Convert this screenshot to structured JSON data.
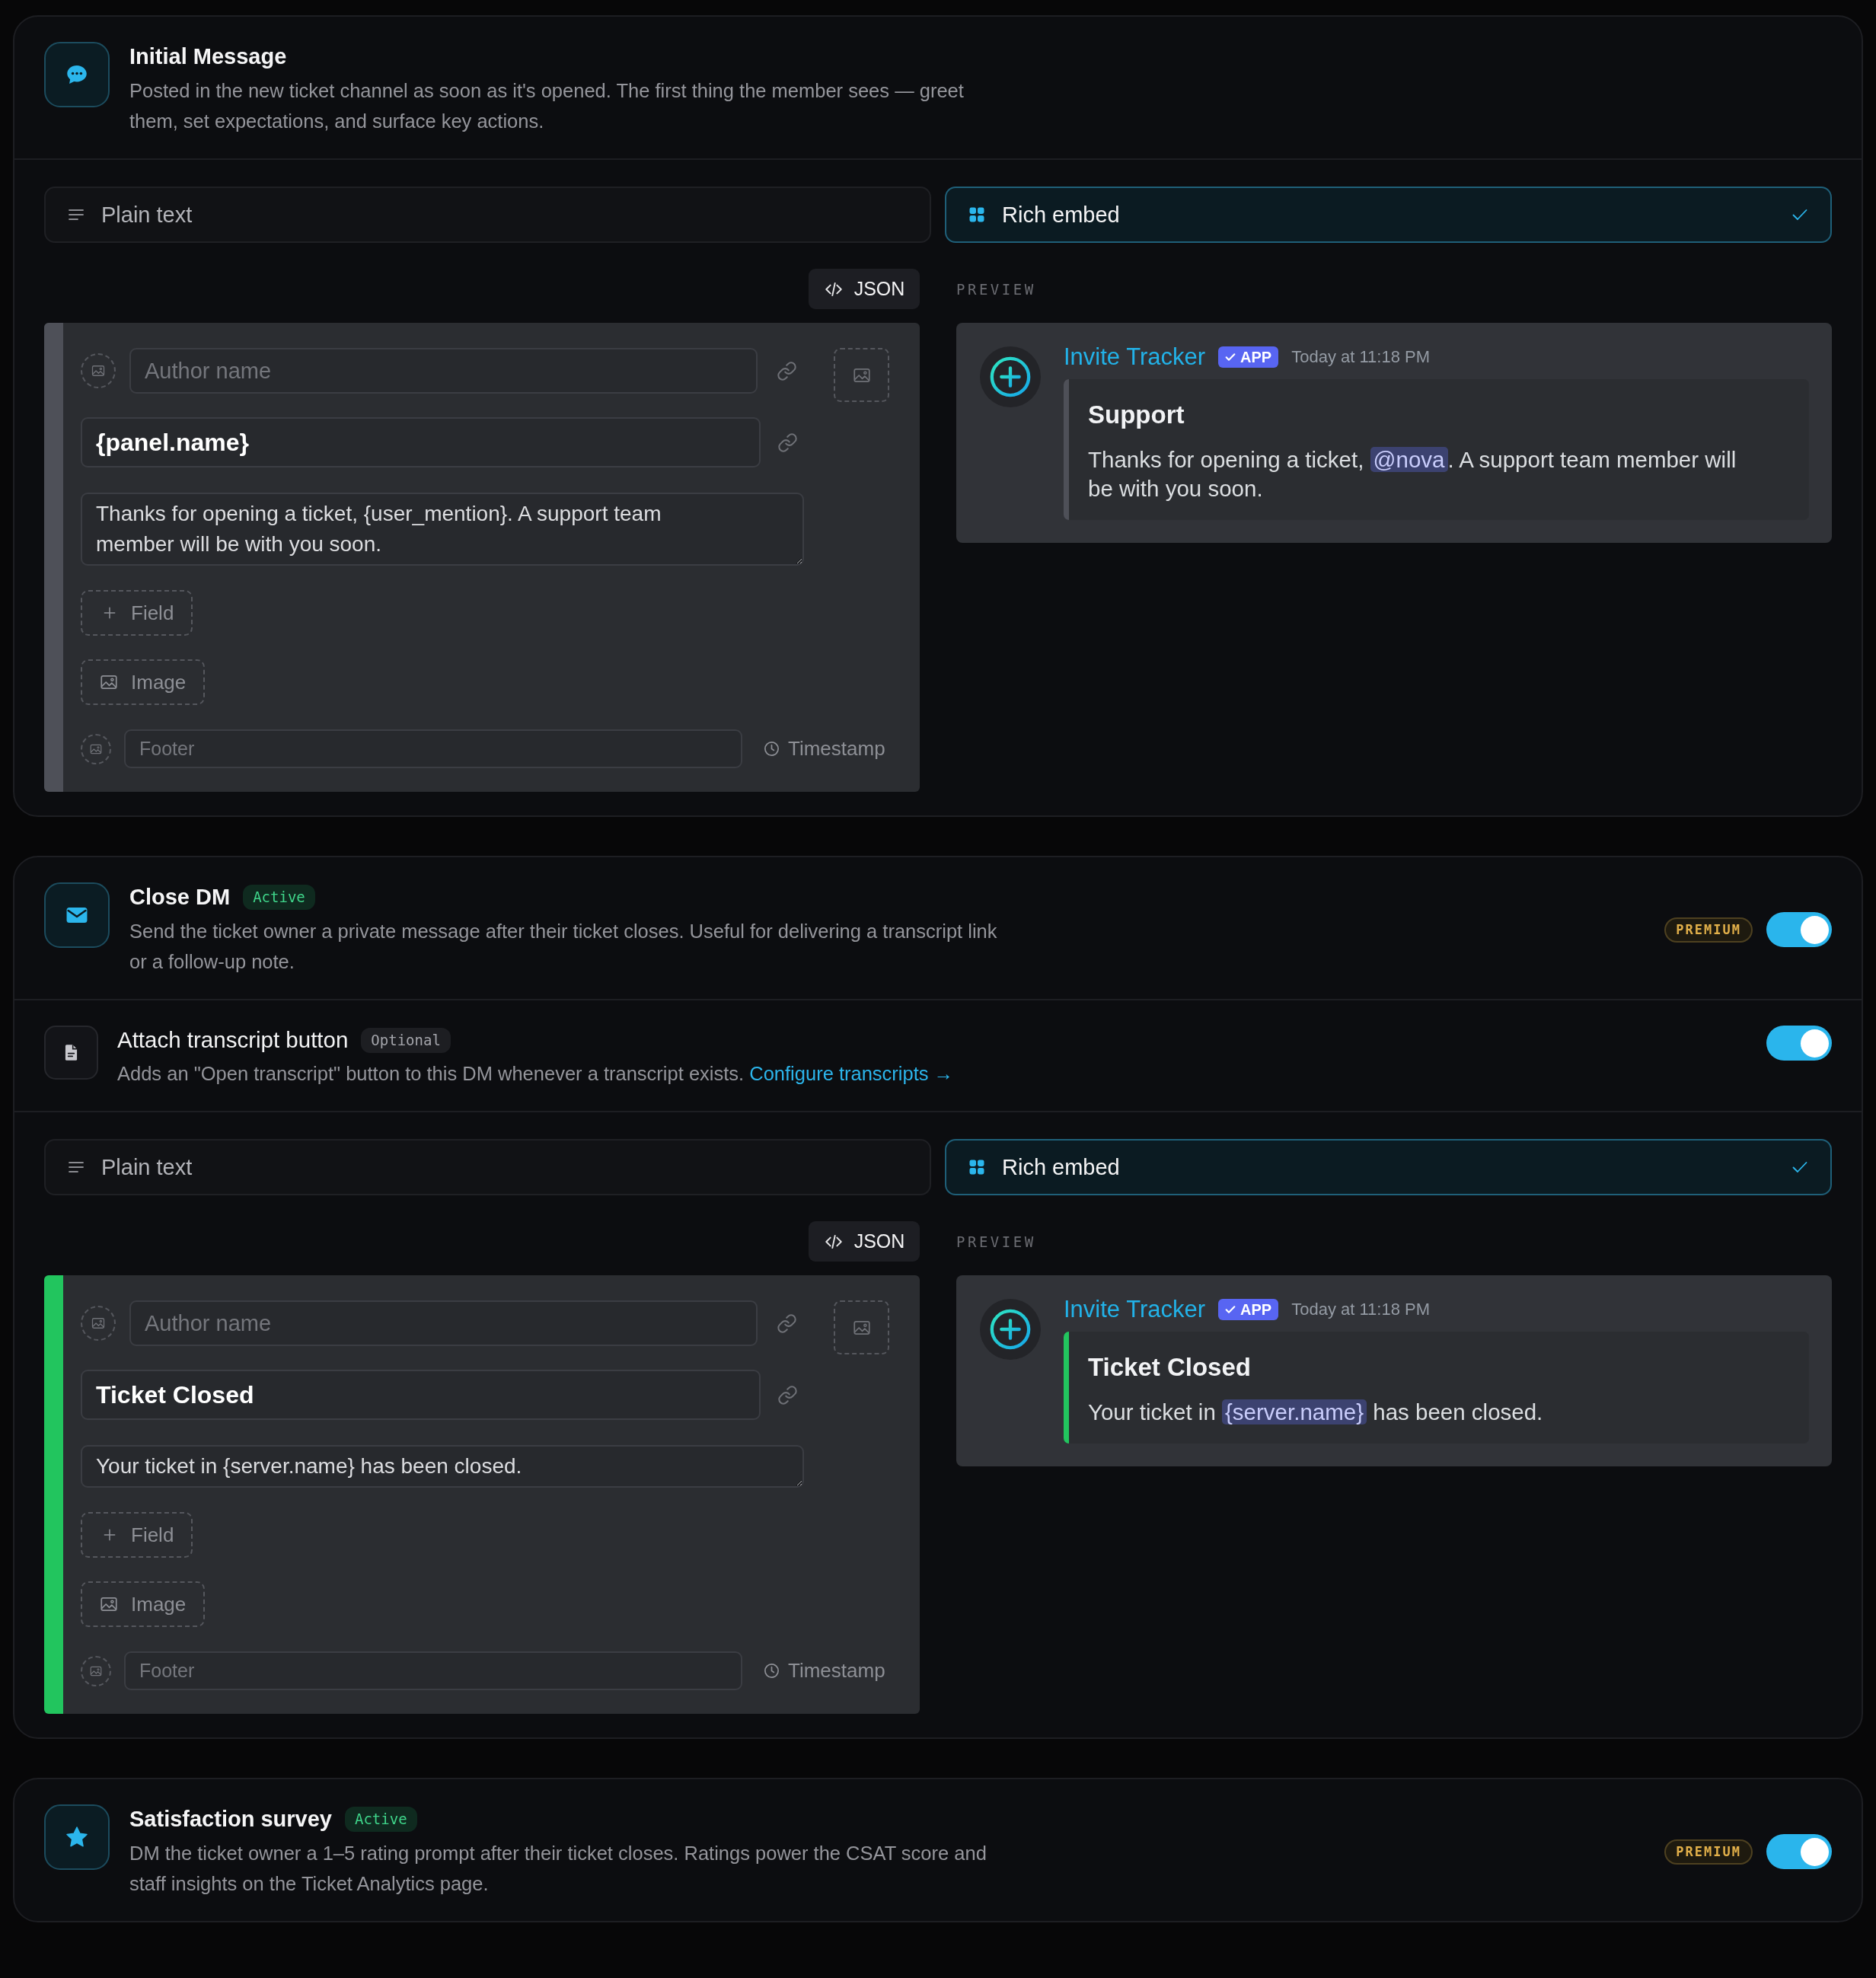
{
  "sections": [
    {
      "kind": "message",
      "title": "Initial Message",
      "description": "Posted in the new ticket channel as soon as it's opened. The first thing the member sees — greet them, set expectations, and surface key actions.",
      "composer": {
        "color": "#4e5058",
        "modes": [
          {
            "kind": "plain",
            "label": "Plain text",
            "selected": false
          },
          {
            "kind": "embed",
            "label": "Rich embed",
            "selected": true
          }
        ],
        "json_button": "JSON",
        "editor": {
          "author_placeholder": "Author name",
          "title": "{panel.name}",
          "description": "Thanks for opening a ticket, {user_mention}. A support team member will be with you soon.",
          "field_button": "Field",
          "image_button": "Image",
          "footer_placeholder": "Footer",
          "timestamp": "Timestamp"
        },
        "preview": {
          "label": "PREVIEW",
          "bot_name": "Invite Tracker",
          "bot_tag": "APP",
          "time": "Today at 11:18 PM",
          "embed_title": "Support",
          "embed_description": [
            {
              "kind": "text",
              "text": "Thanks for opening a ticket, "
            },
            {
              "kind": "mention",
              "text": "@nova"
            },
            {
              "kind": "text",
              "text": ". A support team member will be with you soon."
            }
          ]
        }
      }
    },
    {
      "kind": "dm",
      "title": "Close DM",
      "status": "Active",
      "description": "Send the ticket owner a private message after their ticket closes. Useful for delivering a transcript link or a follow-up note.",
      "premium": "PREMIUM",
      "on": true,
      "options": [
        {
          "kind": "transcript",
          "title": "Attach transcript button",
          "tag": "Optional",
          "description": "Adds an \"Open transcript\" button to this DM whenever a transcript exists.",
          "link": "Configure transcripts →",
          "on": true
        }
      ],
      "composer": {
        "color": "#22c55e",
        "modes": [
          {
            "kind": "plain",
            "label": "Plain text",
            "selected": false
          },
          {
            "kind": "embed",
            "label": "Rich embed",
            "selected": true
          }
        ],
        "json_button": "JSON",
        "editor": {
          "author_placeholder": "Author name",
          "title": "Ticket Closed",
          "description": "Your ticket in {server.name} has been closed.",
          "field_button": "Field",
          "image_button": "Image",
          "footer_placeholder": "Footer",
          "timestamp": "Timestamp"
        },
        "preview": {
          "label": "PREVIEW",
          "bot_name": "Invite Tracker",
          "bot_tag": "APP",
          "time": "Today at 11:18 PM",
          "embed_title": "Ticket Closed",
          "embed_description": [
            {
              "kind": "text",
              "text": "Your ticket in "
            },
            {
              "kind": "mention",
              "text": "{server.name}"
            },
            {
              "kind": "text",
              "text": " has been closed."
            }
          ]
        }
      }
    },
    {
      "kind": "survey",
      "title": "Satisfaction survey",
      "status": "Active",
      "description": "DM the ticket owner a 1–5 rating prompt after their ticket closes. Ratings power the CSAT score and staff insights on the Ticket Analytics page.",
      "premium": "PREMIUM",
      "on": true
    }
  ]
}
